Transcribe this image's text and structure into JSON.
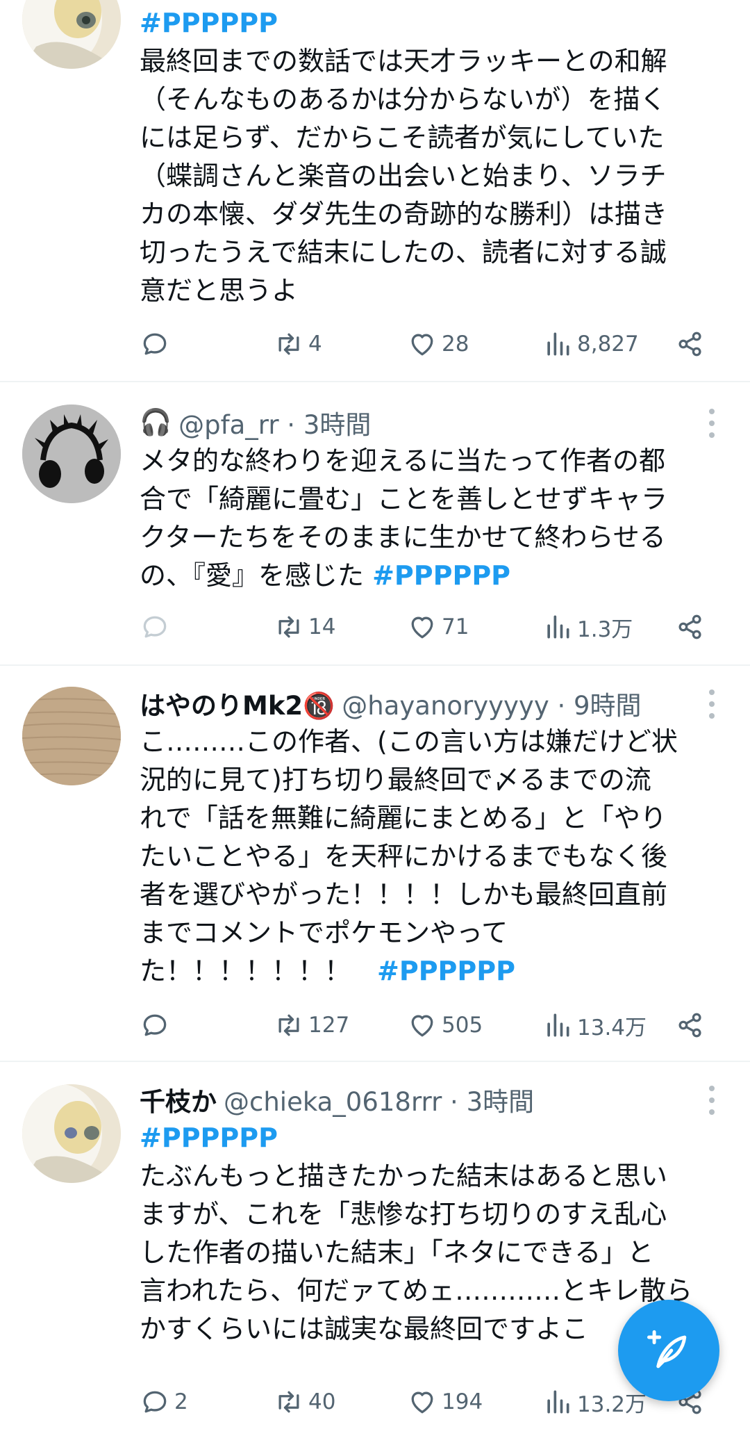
{
  "tweets": [
    {
      "name": "",
      "handle": "",
      "time": "",
      "hashtag_top": "#PPPPPP",
      "lines": [
        "最終回までの数話では天才ラッキーとの和解",
        "（そんなものあるかは分からないが）を描く",
        "には足らず、だからこそ読者が気にしていた",
        "（蝶調さんと楽音の出会いと始まり、ソラチ",
        "カの本懐、ダダ先生の奇跡的な勝利）は描き",
        "切ったうえで結末にしたの、読者に対する誠",
        "意だと思うよ"
      ],
      "replies": "",
      "retweets": "4",
      "likes": "28",
      "views": "8,827"
    },
    {
      "name": "🎧",
      "handle": "@pfa_rr · 3時間",
      "lines": [
        "メタ的な終わりを迎えるに当たって作者の都",
        "合で「綺麗に畳む」ことを善しとせずキャラ",
        "クターたちをそのままに生かせて終わらせる"
      ],
      "last_line": "の、『愛』を感じた ",
      "hashtag_end": "#PPPPPP",
      "replies": "",
      "retweets": "14",
      "likes": "71",
      "views": "1.3万"
    },
    {
      "name": "はやのりMk2🔞",
      "handle": "@hayanoryyyyy · 9時間",
      "lines": [
        "こ………この作者、(この言い方は嫌だけど状",
        "況的に見て)打ち切り最終回で〆るまでの流",
        "れで「話を無難に綺麗にまとめる」と「やり",
        "たいことやる」を天秤にかけるまでもなく後",
        "者を選びやがった！！！！しかも最終回直前",
        "までコメントでポケモンやって"
      ],
      "last_line": "た！！！！！！！　",
      "hashtag_end": "#PPPPPP",
      "replies": "",
      "retweets": "127",
      "likes": "505",
      "views": "13.4万"
    },
    {
      "name": "千枝か",
      "handle": "@chieka_0618rrr · 3時間",
      "hashtag_top": "#PPPPPP",
      "lines": [
        "たぶんもっと描きたかった結末はあると思い",
        "ますが、これを「悲惨な打ち切りのすえ乱心",
        "した作者の描いた結末」「ネタにできる」と",
        "言われたら、何だァてめェ…………とキレ散ら",
        "かすくらいには誠実な最終回ですよこ"
      ],
      "replies": "2",
      "retweets": "40",
      "likes": "194",
      "views": "13.2万"
    }
  ],
  "icons": {
    "reply": "reply-icon",
    "retweet": "retweet-icon",
    "like": "heart-icon",
    "views": "views-icon",
    "share": "share-icon",
    "compose": "compose-icon"
  },
  "colors": {
    "accent": "#1d9bf0",
    "text": "#0f1419",
    "muted": "#536471",
    "divider": "#eff3f4"
  }
}
